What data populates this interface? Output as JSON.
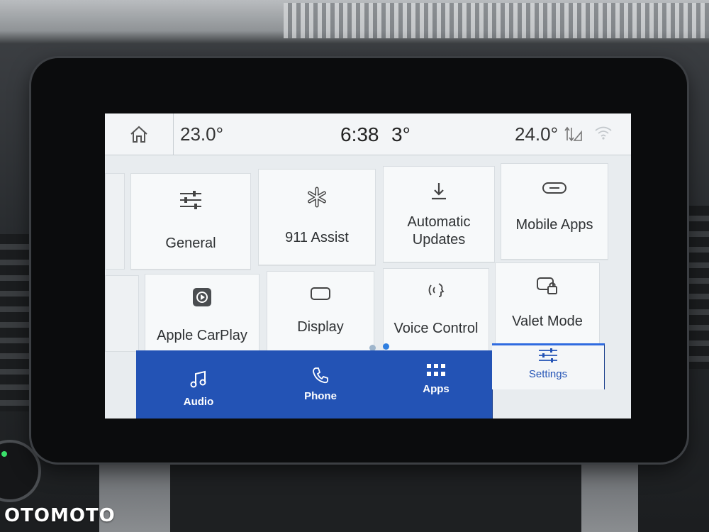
{
  "status_bar": {
    "driver_temp": "23.0°",
    "time": "6:38",
    "outside_temp": "3°",
    "passenger_temp": "24.0°"
  },
  "tiles": [
    {
      "label": "General",
      "icon": "sliders-icon"
    },
    {
      "label": "911 Assist",
      "icon": "star-of-life-icon"
    },
    {
      "label": "Automatic Updates",
      "icon": "download-icon"
    },
    {
      "label": "Mobile Apps",
      "icon": "link-icon"
    },
    {
      "label": "Apple CarPlay",
      "icon": "carplay-icon"
    },
    {
      "label": "Display",
      "icon": "display-icon"
    },
    {
      "label": "Voice Control",
      "icon": "voice-icon"
    },
    {
      "label": "Valet Mode",
      "icon": "valet-lock-icon"
    }
  ],
  "page_indicator": {
    "pages": 2,
    "current": 2
  },
  "nav": [
    {
      "label": "Audio",
      "icon": "music-note-icon"
    },
    {
      "label": "Phone",
      "icon": "phone-icon"
    },
    {
      "label": "Apps",
      "icon": "grid-icon"
    },
    {
      "label": "Settings",
      "icon": "sliders-icon",
      "active": true
    }
  ],
  "watermark": "OTOMOTO",
  "colors": {
    "nav_blue": "#2353b5",
    "accent": "#2f6be0",
    "tile_bg": "#f7f9fa"
  }
}
